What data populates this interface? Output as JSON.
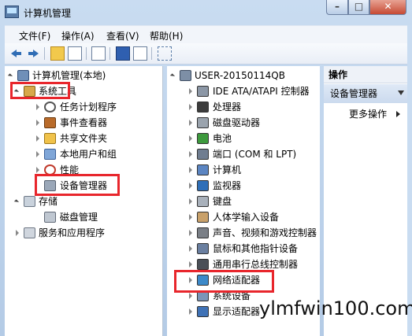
{
  "window": {
    "title": "计算机管理"
  },
  "menu": [
    "文件(F)",
    "操作(A)",
    "查看(V)",
    "帮助(H)"
  ],
  "left_tree": [
    {
      "label": "计算机管理(本地)",
      "level": 0,
      "expanded": true,
      "icon": "computer-icon"
    },
    {
      "label": "系统工具",
      "level": 1,
      "expanded": true,
      "icon": "tools-icon"
    },
    {
      "label": "任务计划程序",
      "level": 2,
      "icon": "clock-icon"
    },
    {
      "label": "事件查看器",
      "level": 2,
      "icon": "event-viewer-icon"
    },
    {
      "label": "共享文件夹",
      "level": 2,
      "icon": "shared-folder-icon"
    },
    {
      "label": "本地用户和组",
      "level": 2,
      "icon": "users-icon"
    },
    {
      "label": "性能",
      "level": 2,
      "icon": "performance-icon"
    },
    {
      "label": "设备管理器",
      "level": 2,
      "icon": "device-manager-icon",
      "selected": true
    },
    {
      "label": "存储",
      "level": 1,
      "expanded": true,
      "icon": "storage-icon"
    },
    {
      "label": "磁盘管理",
      "level": 2,
      "icon": "disk-icon"
    },
    {
      "label": "服务和应用程序",
      "level": 1,
      "icon": "services-icon"
    }
  ],
  "device_tree": {
    "root": "USER-20150114QB",
    "items": [
      "IDE ATA/ATAPI 控制器",
      "处理器",
      "磁盘驱动器",
      "电池",
      "端口 (COM 和 LPT)",
      "计算机",
      "监视器",
      "键盘",
      "人体学输入设备",
      "声音、视频和游戏控制器",
      "鼠标和其他指针设备",
      "通用串行总线控制器",
      "网络适配器",
      "系统设备",
      "显示适配器"
    ]
  },
  "actions": {
    "header": "操作",
    "section": "设备管理器",
    "more": "更多操作"
  },
  "watermark": "ylmfwin100.com",
  "colors": {
    "highlight": "#e8262c",
    "title_bg": "#c9dcf1"
  }
}
